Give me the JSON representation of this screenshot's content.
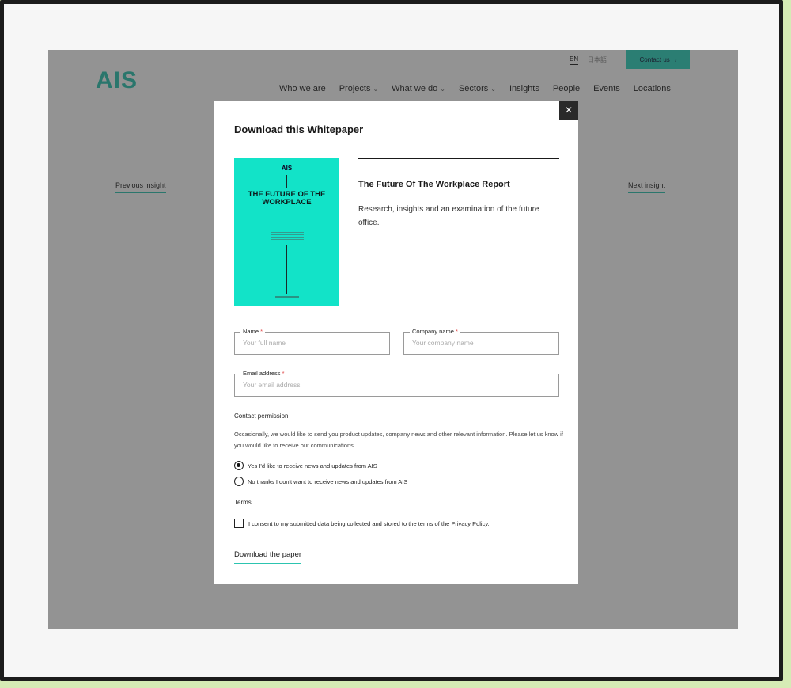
{
  "site": {
    "logo": "AIS",
    "languages": {
      "en": "EN",
      "jp": "日本語"
    },
    "contact_button": "Contact us",
    "nav": [
      {
        "label": "Who we are",
        "chevron": false
      },
      {
        "label": "Projects",
        "chevron": true
      },
      {
        "label": "What we do",
        "chevron": true
      },
      {
        "label": "Sectors",
        "chevron": true
      },
      {
        "label": "Insights",
        "chevron": false
      },
      {
        "label": "People",
        "chevron": false
      },
      {
        "label": "Events",
        "chevron": false
      },
      {
        "label": "Locations",
        "chevron": false
      }
    ],
    "previous_insight": "Previous insight",
    "next_insight": "Next insight"
  },
  "modal": {
    "title": "Download this Whitepaper",
    "close_icon": "×",
    "cover": {
      "logo": "AIS",
      "title": "THE FUTURE OF THE WORKPLACE"
    },
    "report_title": "The Future Of The Workplace Report",
    "report_description": "Research, insights and an examination of the future office.",
    "fields": {
      "name": {
        "label": "Name",
        "required_mark": "*",
        "placeholder": "Your full name"
      },
      "company": {
        "label": "Company name",
        "required_mark": "*",
        "placeholder": "Your company name"
      },
      "email": {
        "label": "Email address",
        "required_mark": "*",
        "placeholder": "Your email address"
      }
    },
    "contact_permission": {
      "label": "Contact permission",
      "text": "Occasionally, we would like to send you product updates, company news and other relevant information. Please let us know if you would like to receive our communications.",
      "options": [
        {
          "label": "Yes I'd like to receive news and updates from AIS",
          "selected": true
        },
        {
          "label": "No thanks I don't want to receive news and updates from AIS",
          "selected": false
        }
      ]
    },
    "terms": {
      "label": "Terms",
      "consent": "I consent to my submitted data being collected and stored to the terms of the Privacy Policy.",
      "checked": false
    },
    "download_button": "Download the paper"
  },
  "colors": {
    "accent": "#2cc4b0",
    "cover": "#12e3c8",
    "contact_button": "#2ed5bf",
    "overlay": "#808080"
  },
  "icons": {
    "close": "close-icon",
    "chevron": "chevron-down-icon",
    "contact_arrow": "chevron-right-icon"
  }
}
